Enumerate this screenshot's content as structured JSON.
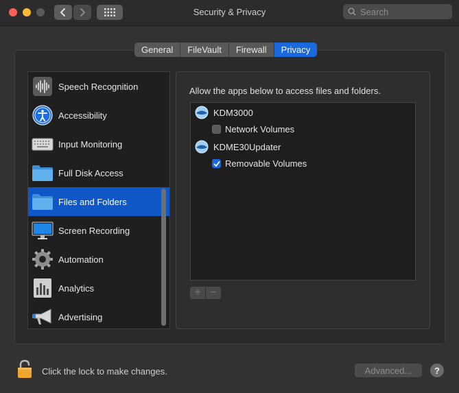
{
  "window": {
    "title": "Security & Privacy",
    "search_placeholder": "Search"
  },
  "tabs": [
    {
      "label": "General",
      "active": false
    },
    {
      "label": "FileVault",
      "active": false
    },
    {
      "label": "Firewall",
      "active": false
    },
    {
      "label": "Privacy",
      "active": true
    }
  ],
  "sidebar": {
    "items": [
      {
        "label": "Speech Recognition",
        "icon": "waveform-icon",
        "selected": false
      },
      {
        "label": "Accessibility",
        "icon": "accessibility-icon",
        "selected": false
      },
      {
        "label": "Input Monitoring",
        "icon": "keyboard-icon",
        "selected": false
      },
      {
        "label": "Full Disk Access",
        "icon": "folder-icon",
        "selected": false
      },
      {
        "label": "Files and Folders",
        "icon": "folder-icon",
        "selected": true
      },
      {
        "label": "Screen Recording",
        "icon": "display-icon",
        "selected": false
      },
      {
        "label": "Automation",
        "icon": "gear-icon",
        "selected": false
      },
      {
        "label": "Analytics",
        "icon": "analytics-icon",
        "selected": false
      },
      {
        "label": "Advertising",
        "icon": "megaphone-icon",
        "selected": false
      }
    ]
  },
  "panel": {
    "instruction": "Allow the apps below to access files and folders.",
    "apps": [
      {
        "name": "KDM3000",
        "permission": "Network Volumes",
        "checked": false
      },
      {
        "name": "KDME30Updater",
        "permission": "Removable Volumes",
        "checked": true
      }
    ],
    "add_label": "+",
    "remove_label": "−"
  },
  "footer": {
    "lock_text": "Click the lock to make changes.",
    "advanced_label": "Advanced...",
    "help_label": "?"
  },
  "colors": {
    "accent": "#1b69de",
    "selection": "#0f57c6",
    "background": "#323232"
  }
}
